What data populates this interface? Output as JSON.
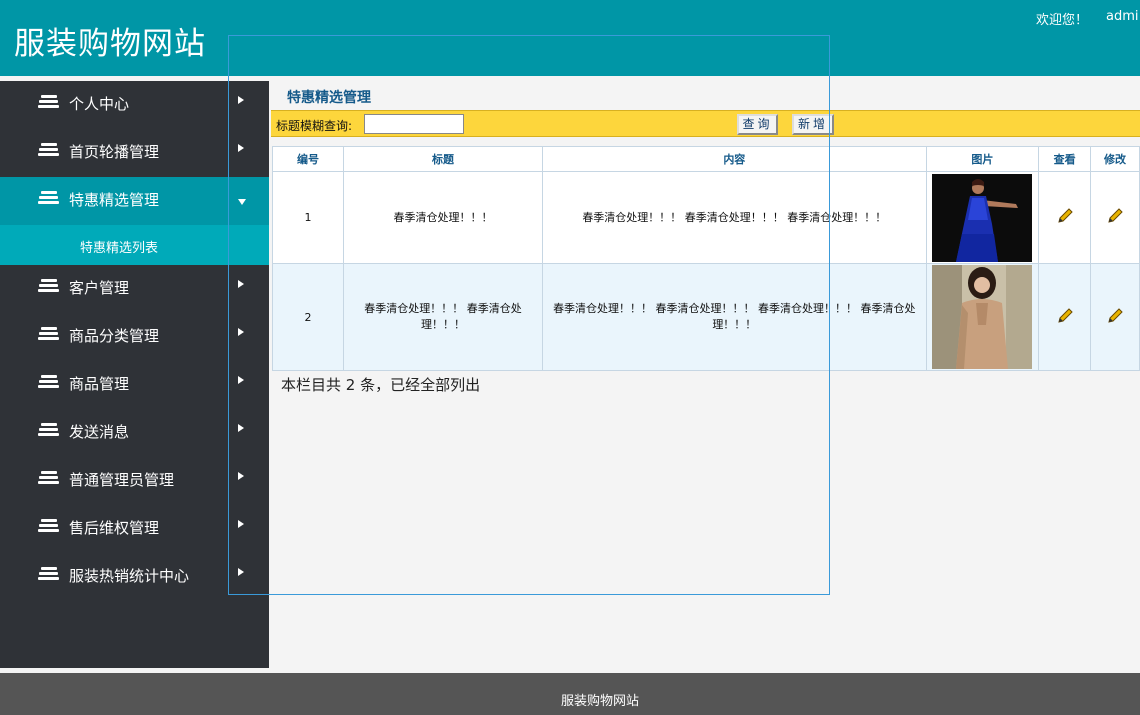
{
  "header": {
    "title": "服装购物网站",
    "welcome": "欢迎您！",
    "user": "admi"
  },
  "sidebar": {
    "items": [
      {
        "label": "个人中心"
      },
      {
        "label": "首页轮播管理"
      },
      {
        "label": "特惠精选管理",
        "active": true,
        "sub": "特惠精选列表"
      },
      {
        "label": "客户管理"
      },
      {
        "label": "商品分类管理"
      },
      {
        "label": "商品管理"
      },
      {
        "label": "发送消息"
      },
      {
        "label": "普通管理员管理"
      },
      {
        "label": "售后维权管理"
      },
      {
        "label": "服装热销统计中心"
      }
    ]
  },
  "main": {
    "title": "特惠精选管理",
    "search": {
      "label": "标题模糊查询:",
      "value": "",
      "query_button": "查询",
      "add_button": "新增"
    },
    "table": {
      "headers": [
        "编号",
        "标题",
        "内容",
        "图片",
        "查看",
        "修改"
      ],
      "rows": [
        {
          "id": "1",
          "title": "春季清仓处理！！！",
          "content": "春季清仓处理！！！ 春季清仓处理！！！ 春季清仓处理！！！",
          "image": "woman-blue-dress-photo"
        },
        {
          "id": "2",
          "title": "春季清仓处理！！！ 春季清仓处理！！！",
          "content": "春季清仓处理！！！ 春季清仓处理！！！ 春季清仓处理！！！ 春季清仓处理！！！",
          "image": "woman-beige-coat-photo"
        }
      ]
    },
    "summary": "本栏目共 2 条，已经全部列出"
  },
  "footer": {
    "text": "服装购物网站"
  },
  "colors": {
    "header": "#0096a6",
    "sidebar": "#2f3237",
    "active": "#0096a6",
    "sub": "#00aab9",
    "search_bar": "#fdd63c",
    "row_alt": "#eaf5fc",
    "footer": "#555555"
  }
}
